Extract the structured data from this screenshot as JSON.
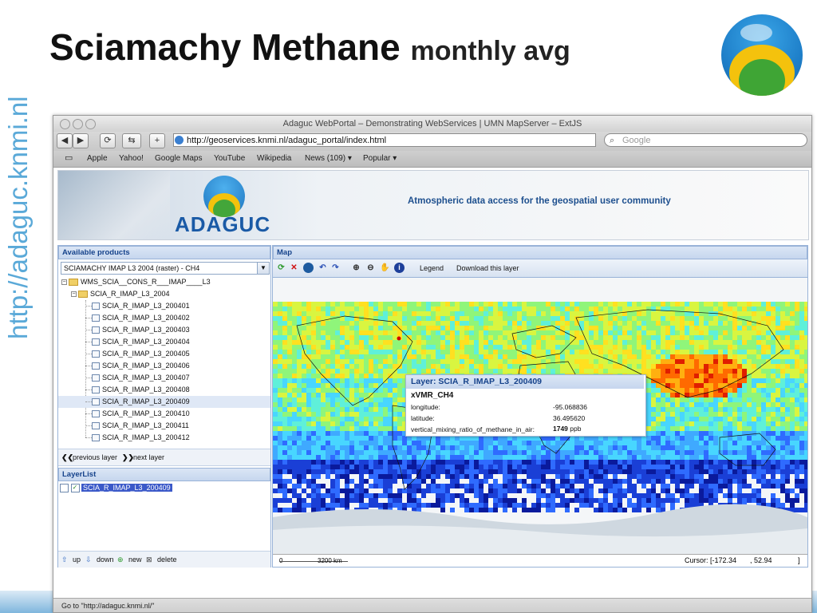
{
  "slide": {
    "title": "Sciamachy Methane",
    "subtitle": "monthly avg",
    "side_text": "http://adaguc.knmi.nl"
  },
  "browser": {
    "window_title": "Adaguc WebPortal – Demonstrating WebServices | UMN MapServer – ExtJS",
    "url": "http://geoservices.knmi.nl/adaguc_portal/index.html",
    "search_placeholder": "Google",
    "bookmarks": [
      "Apple",
      "Yahoo!",
      "Google Maps",
      "YouTube",
      "Wikipedia",
      "News (109) ▾",
      "Popular ▾"
    ],
    "status": "Go to \"http://adaguc.knmi.nl/\""
  },
  "banner": {
    "logo_text": "ADAGUC",
    "tagline": "Atmospheric data access for the geospatial user community"
  },
  "products": {
    "header": "Available products",
    "selected": "SCIAMACHY IMAP L3 2004 (raster) - CH4",
    "root": "WMS_SCIA__CONS_R___IMAP____L3",
    "folder": "SCIA_R_IMAP_L3_2004",
    "layers": [
      "SCIA_R_IMAP_L3_200401",
      "SCIA_R_IMAP_L3_200402",
      "SCIA_R_IMAP_L3_200403",
      "SCIA_R_IMAP_L3_200404",
      "SCIA_R_IMAP_L3_200405",
      "SCIA_R_IMAP_L3_200406",
      "SCIA_R_IMAP_L3_200407",
      "SCIA_R_IMAP_L3_200408",
      "SCIA_R_IMAP_L3_200409",
      "SCIA_R_IMAP_L3_200410",
      "SCIA_R_IMAP_L3_200411",
      "SCIA_R_IMAP_L3_200412"
    ],
    "selected_layer_index": 8,
    "prev_label": "previous layer",
    "next_label": "next layer"
  },
  "layerlist": {
    "header": "LayerList",
    "item": "SCIA_R_IMAP_L3_200409",
    "up": "up",
    "down": "down",
    "new": "new",
    "delete": "delete"
  },
  "map": {
    "header": "Map",
    "legend": "Legend",
    "download": "Download this layer",
    "scale_zero": "0",
    "scale_label": "3200 km",
    "cursor_label": "Cursor: [-172.34",
    "cursor_lat": ", 52.94",
    "cursor_end": "]"
  },
  "popup": {
    "title": "Layer: SCIA_R_IMAP_L3_200409",
    "variable": "xVMR_CH4",
    "lon_label": "longitude:",
    "lon_value": "-95.068836",
    "lat_label": "latitude:",
    "lat_value": "36.495620",
    "vmr_label": "vertical_mixing_ratio_of_methane_in_air:",
    "vmr_value": "1749",
    "vmr_unit": "ppb"
  },
  "colors": {
    "accent": "#15428b",
    "selection": "#3b59c9",
    "side_text": "#5aa9d8"
  }
}
